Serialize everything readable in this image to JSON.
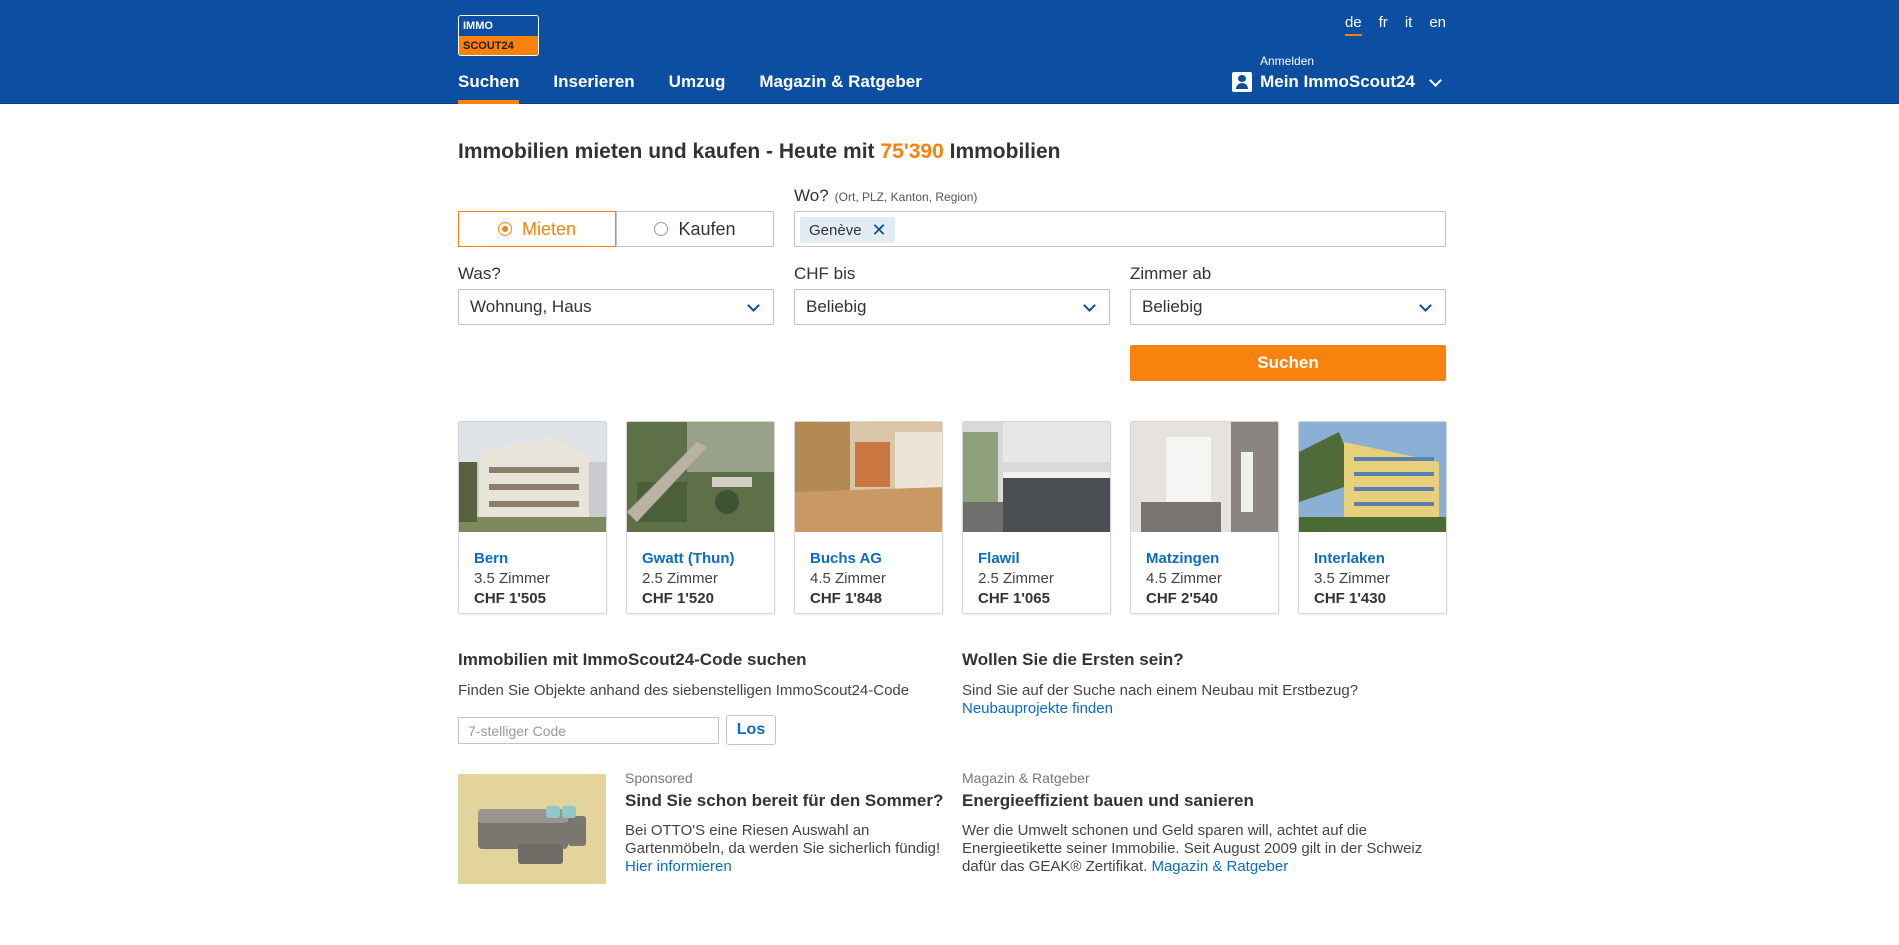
{
  "header": {
    "logo_line1": "IMMO",
    "logo_line2": "SCOUT24",
    "languages": [
      "de",
      "fr",
      "it",
      "en"
    ],
    "active_language": "de",
    "nav": [
      "Suchen",
      "Inserieren",
      "Umzug",
      "Magazin & Ratgeber"
    ],
    "active_nav": "Suchen",
    "account_small": "Anmelden",
    "account_name": "Mein ImmoScout24"
  },
  "search": {
    "headline_prefix": "Immobilien mieten und kaufen - Heute mit ",
    "headline_count": "75'390",
    "headline_suffix": " Immobilien",
    "toggle": {
      "rent": "Mieten",
      "buy": "Kaufen",
      "selected": "Mieten"
    },
    "where_label": "Wo?",
    "where_hint": "(Ort, PLZ, Kanton, Region)",
    "where_chip": "Genève",
    "what_label": "Was?",
    "what_value": "Wohnung, Haus",
    "price_label": "CHF bis",
    "price_value": "Beliebig",
    "rooms_label": "Zimmer ab",
    "rooms_value": "Beliebig",
    "submit": "Suchen"
  },
  "listings": [
    {
      "city": "Bern",
      "rooms": "3.5 Zimmer",
      "price": "CHF 1'505"
    },
    {
      "city": "Gwatt (Thun)",
      "rooms": "2.5 Zimmer",
      "price": "CHF 1'520"
    },
    {
      "city": "Buchs AG",
      "rooms": "4.5 Zimmer",
      "price": "CHF 1'848"
    },
    {
      "city": "Flawil",
      "rooms": "2.5 Zimmer",
      "price": "CHF 1'065"
    },
    {
      "city": "Matzingen",
      "rooms": "4.5 Zimmer",
      "price": "CHF 2'540"
    },
    {
      "city": "Interlaken",
      "rooms": "3.5 Zimmer",
      "price": "CHF 1'430"
    }
  ],
  "code_search": {
    "title": "Immobilien mit ImmoScout24-Code suchen",
    "text": "Finden Sie Objekte anhand des siebenstelligen ImmoScout24-Code",
    "placeholder": "7-stelliger Code",
    "button": "Los"
  },
  "new_build": {
    "title": "Wollen Sie die Ersten sein?",
    "text": "Sind Sie auf der Suche nach einem Neubau mit Erstbezug?",
    "link": "Neubauprojekte finden"
  },
  "sponsored": {
    "tag": "Sponsored",
    "title": "Sind Sie schon bereit für den Sommer?",
    "text": "Bei OTTO'S eine Riesen Auswahl an Gartenmöbeln, da werden Sie sicherlich fündig!",
    "link": "Hier informieren"
  },
  "magazine": {
    "tag": "Magazin & Ratgeber",
    "title": "Energieeffizient bauen und sanieren",
    "text": "Wer die Umwelt schonen und Geld sparen will, achtet auf die Energieetikette seiner Immobilie. Seit August 2009 gilt in der Schweiz dafür das GEAK® Zertifikat.",
    "link": "Magazin & Ratgeber"
  },
  "colors": {
    "brand_blue": "#0b4ea2",
    "accent_orange": "#f9820f",
    "link_blue": "#0b6cc4"
  }
}
